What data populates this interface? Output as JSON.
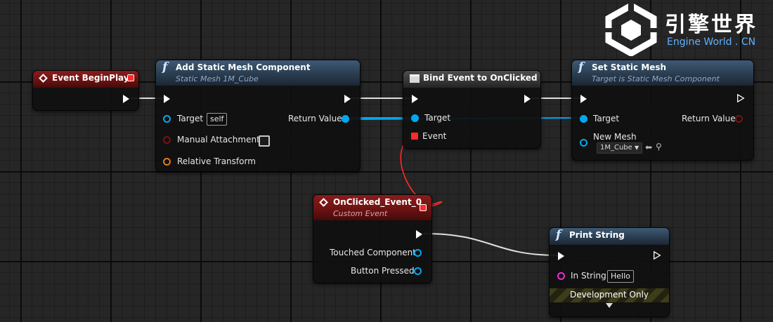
{
  "logo": {
    "cn": "引擎世界",
    "en": "Engine World . CN"
  },
  "nodes": {
    "begin_play": {
      "title": "Event BeginPlay"
    },
    "add_mesh": {
      "title": "Add Static Mesh Component",
      "subtitle": "Static Mesh 1M_Cube",
      "target_label": "Target",
      "target_value": "self",
      "return_label": "Return Value",
      "manual_label": "Manual Attachment",
      "transform_label": "Relative Transform"
    },
    "bind_event": {
      "title": "Bind Event to OnClicked",
      "target_label": "Target",
      "event_label": "Event"
    },
    "set_mesh": {
      "title": "Set Static Mesh",
      "subtitle": "Target is Static Mesh Component",
      "target_label": "Target",
      "return_label": "Return Value",
      "new_mesh_label": "New Mesh",
      "new_mesh_value": "1M_Cube"
    },
    "clicked_event": {
      "title": "OnClicked_Event_0",
      "subtitle": "Custom Event",
      "touched_label": "Touched Component",
      "button_label": "Button Pressed"
    },
    "print_string": {
      "title": "Print String",
      "in_string_label": "In String",
      "in_string_value": "Hello",
      "dev_only_label": "Development Only"
    }
  },
  "colors": {
    "exec_wire": "#e0e0e0",
    "object_wire": "#00a8f0",
    "delegate_wire": "#ff2a2a",
    "function_header": "#2a3d50",
    "event_header": "#6c1313"
  },
  "icons": {
    "function": "function-f-icon",
    "event": "event-diamond-icon",
    "bind": "bind-event-icon",
    "exec": "exec-pin-icon",
    "delegate": "delegate-square-pin-icon",
    "browse": "browse-arrow-icon",
    "search": "search-icon",
    "expand": "chevron-down-icon"
  }
}
